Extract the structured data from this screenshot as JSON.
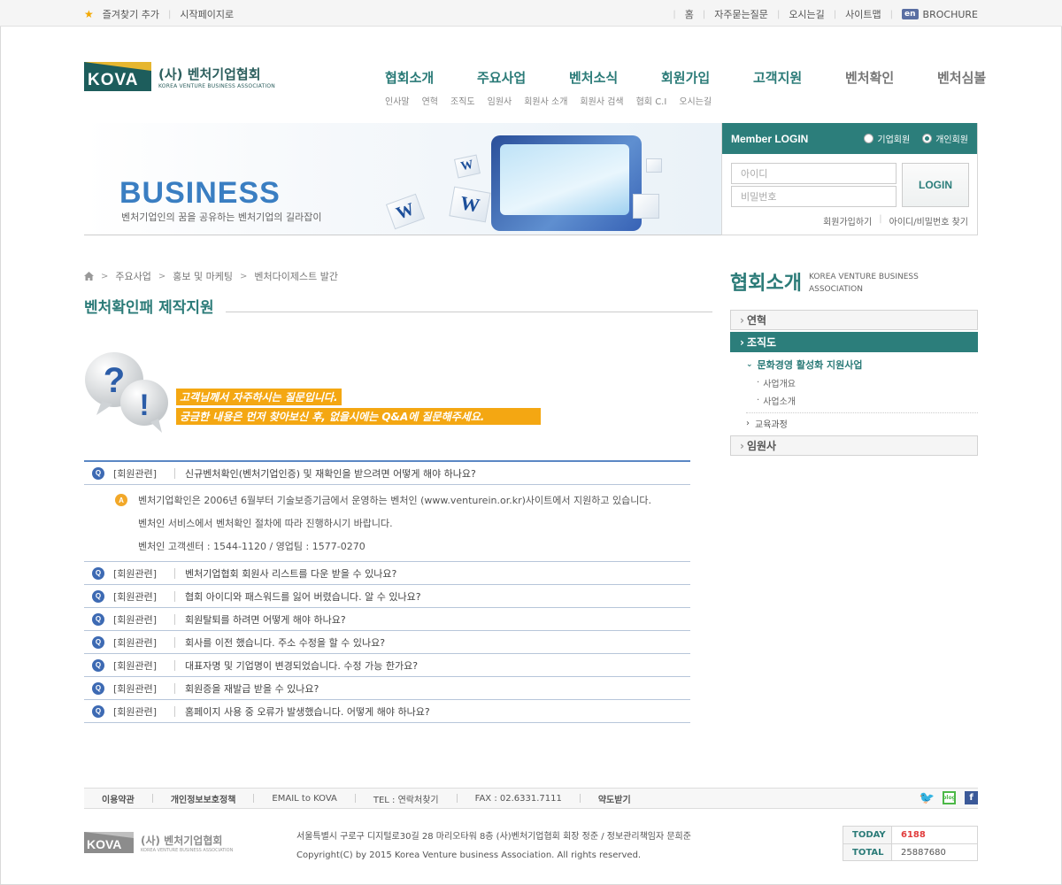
{
  "topbar": {
    "favorite": "즐겨찾기 추가",
    "homepage": "시작페이지로",
    "links": [
      "홈",
      "자주묻는질문",
      "오시는길",
      "사이트맵"
    ],
    "en_badge": "en",
    "brochure": "BROCHURE"
  },
  "logo": {
    "mark": "KOVA",
    "name_ko": "(사) 벤처기업협회",
    "name_en": "KOREA VENTURE BUSINESS ASSOCIATION"
  },
  "gnb": [
    "협회소개",
    "주요사업",
    "벤처소식",
    "회원가입",
    "고객지원",
    "벤처확인",
    "벤처심볼"
  ],
  "sub_gnb": [
    "인사말",
    "연혁",
    "조직도",
    "임원사",
    "회원사 소개",
    "회원사 검색",
    "협회 C.I",
    "오시는길"
  ],
  "banner": {
    "title": "BUSINESS",
    "subtitle": "벤처기업인의 꿈을 공유하는 벤처기업의 길라잡이"
  },
  "login": {
    "title": "Member LOGIN",
    "radio_corp": "기업회원",
    "radio_personal": "개인회원",
    "id_placeholder": "아이디",
    "pw_placeholder": "비밀번호",
    "button": "LOGIN",
    "join": "회원가입하기",
    "find": "아이디/비밀번호 찾기"
  },
  "breadcrumb": [
    "주요사업",
    "홍보 및 마케팅",
    "벤처다이제스트 발간"
  ],
  "page_title": "벤처확인패 제작지원",
  "intro": {
    "line1": "고객님께서 자주하시는 질문입니다.",
    "line2": "궁금한 내용은 먼저 찾아보신 후, 없을시에는 Q&A에 질문해주세요."
  },
  "faq": {
    "q_icon": "Q",
    "a_icon": "A",
    "items": [
      {
        "cat": "[회원관련]",
        "q": "신규벤처확인(벤처기업인증) 및 재확인을 받으려면 어떻게 해야 하나요?"
      },
      {
        "cat": "[회원관련]",
        "q": "벤처기업협회 회원사 리스트를 다운 받을 수 있나요?"
      },
      {
        "cat": "[회원관련]",
        "q": "협회 아이디와 패스워드를 잃어 버렸습니다. 알 수 있나요?"
      },
      {
        "cat": "[회원관련]",
        "q": "회원탈퇴를 하려면 어떻게 해야 하나요?"
      },
      {
        "cat": "[회원관련]",
        "q": "회사를 이전 했습니다. 주소 수정을 할 수 있나요?"
      },
      {
        "cat": "[회원관련]",
        "q": "대표자명 및 기업명이 변경되었습니다. 수정 가능 한가요?"
      },
      {
        "cat": "[회원관련]",
        "q": "회원증을 재발급 받을 수 있나요?"
      },
      {
        "cat": "[회원관련]",
        "q": "홈페이지 사용 중 오류가 발생했습니다. 어떻게 해야 하나요?"
      }
    ],
    "answer": [
      "벤처기업확인은 2006년 6월부터 기술보증기금에서 운영하는 벤처인 (www.venturein.or.kr)사이트에서 지원하고 있습니다.",
      "벤처인 서비스에서 벤처확인 절차에 따라 진행하시기 바랍니다.",
      "벤처인 고객센터 : 1544-1120  / 영업팀 : 1577-0270"
    ]
  },
  "side": {
    "title_ko": "협회소개",
    "title_en": "KOREA VENTURE BUSINESS ASSOCIATION",
    "menu1": "연혁",
    "menu2": "조직도",
    "sub_title": "문화경영 활성화 지원사업",
    "sub_items": [
      "사업개요",
      "사업소개"
    ],
    "sub_other": "교육과정",
    "menu3": "임원사"
  },
  "footer": {
    "links": [
      "이용약관",
      "개인정보보호정책",
      "EMAIL to KOVA",
      "TEL : 연락처찾기",
      "FAX : 02.6331.7111",
      "약도받기"
    ],
    "address": "서울특별시 구로구 디지털로30길 28 마리오타워 8층 (사)벤처기업협회 회장 정준  /  정보관리책임자 문희준",
    "copyright": "Copyright(C) by 2015 Korea Venture business Association. All rights reserved.",
    "today_label": "TODAY",
    "today_value": "6188",
    "total_label": "TOTAL",
    "total_value": "25887680"
  },
  "colors": {
    "brand": "#2c7e7b",
    "accent": "#f4a712",
    "faq_border": "#5a87c4"
  }
}
